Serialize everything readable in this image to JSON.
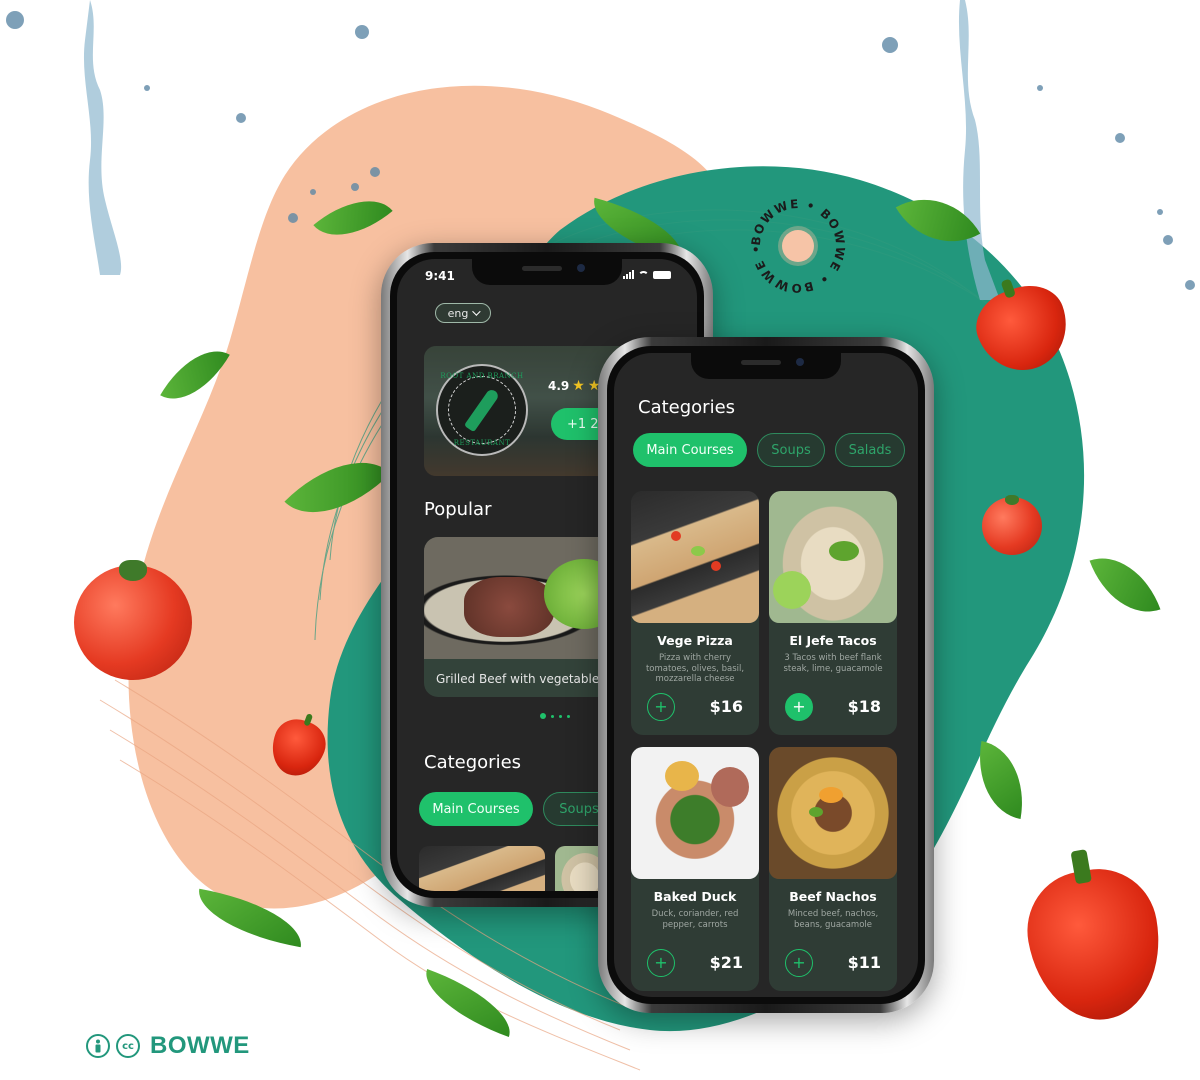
{
  "colors": {
    "teal_blob": "#22977c",
    "peach_blob": "#f7c0a0",
    "accent_green": "#1fc16b",
    "screen_bg": "#262626",
    "card_bg": "#2f3c35"
  },
  "back_phone": {
    "status_time": "9:41",
    "language_selector": {
      "label": "eng",
      "icon": "chevron-down-icon"
    },
    "restaurant": {
      "logo_text_top": "ROOT AND BRANCH",
      "logo_text_bottom": "RESTAURANT",
      "rating": "4.9",
      "stars_visible": 2,
      "stars_total": 5,
      "phone_button_label": "+1 234"
    },
    "popular": {
      "title": "Popular",
      "items": [
        {
          "name": "Grilled Beef with vegetables"
        }
      ],
      "carousel_page": 1,
      "carousel_pages": 4
    },
    "categories": {
      "title": "Categories",
      "chips": [
        {
          "label": "Main Courses",
          "active": true
        },
        {
          "label": "Soups",
          "active": false
        }
      ]
    }
  },
  "front_phone": {
    "categories": {
      "title": "Categories",
      "chips": [
        {
          "label": "Main Courses",
          "active": true
        },
        {
          "label": "Soups",
          "active": false
        },
        {
          "label": "Salads",
          "active": false
        }
      ]
    },
    "dishes": [
      {
        "name": "Vege Pizza",
        "description": "Pizza with cherry tomatoes, olives, basil, mozzarella cheese",
        "price": "$16",
        "added": false,
        "image": "pizza"
      },
      {
        "name": "El Jefe Tacos",
        "description": "3 Tacos with beef flank steak,  lime, guacamole",
        "price": "$18",
        "added": true,
        "image": "tacos"
      },
      {
        "name": "Baked Duck",
        "description": "Duck, coriander, red pepper, carrots",
        "price": "$21",
        "added": false,
        "image": "duck"
      },
      {
        "name": "Beef Nachos",
        "description": "Minced beef, nachos, beans, guacamole",
        "price": "$11",
        "added": false,
        "image": "nachos"
      }
    ],
    "add_icon": "+"
  },
  "badge": {
    "text": "BOWWE • BOWWE • BOWWE •"
  },
  "footer_brand": {
    "license_icons": [
      "attribution-icon",
      "cc-icon"
    ],
    "cc_label": "cc",
    "wordmark": "BOWWE"
  }
}
